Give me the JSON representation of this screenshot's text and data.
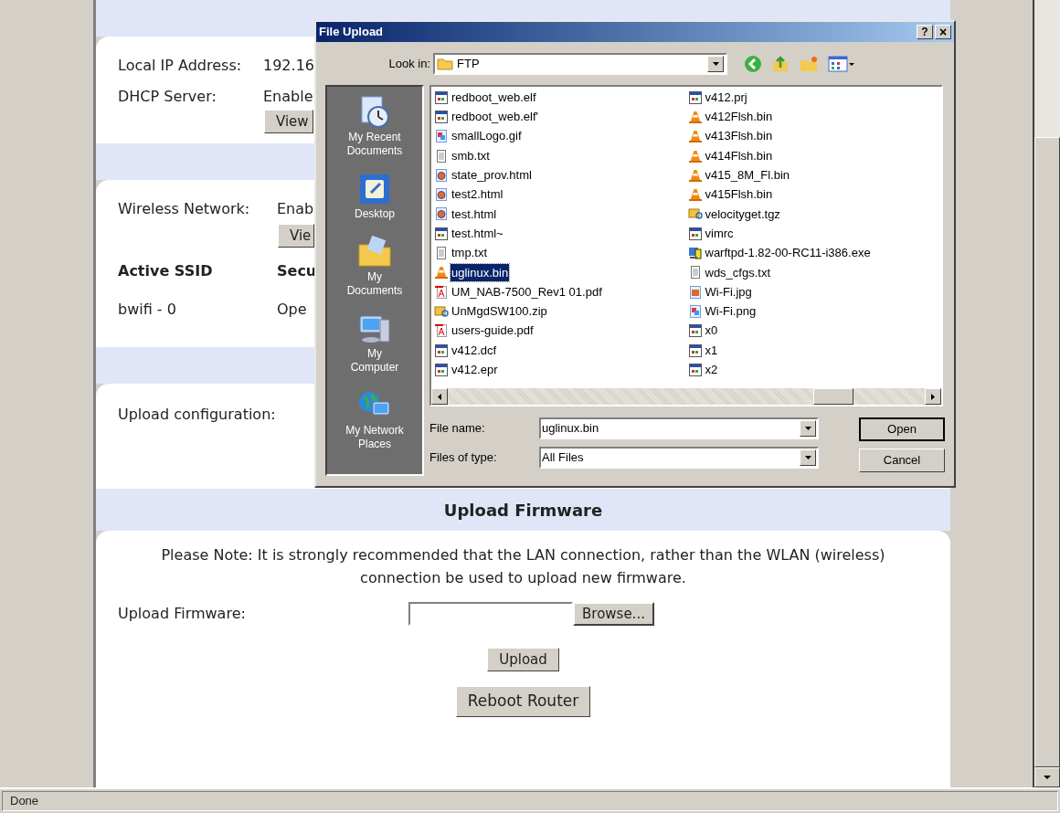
{
  "page": {
    "local": {
      "ip_label": "Local IP Address:",
      "ip_value": "192.16",
      "dhcp_label": "DHCP Server:",
      "dhcp_value": "Enable",
      "view_button": "View"
    },
    "wireless": {
      "label": "Wireless Network:",
      "value": "Enab",
      "view_button": "Vie",
      "columns": [
        "Active SSID",
        "Secu"
      ],
      "rows": [
        [
          "bwifi - 0",
          "Ope"
        ]
      ]
    },
    "config": {
      "label": "Upload configuration:"
    },
    "firmware": {
      "title": "Upload Firmware",
      "note": "Please Note: It is strongly recommended that the LAN connection, rather than the WLAN (wireless) connection be used to upload new firmware.",
      "label": "Upload Firmware:",
      "browse_button": "Browse...",
      "upload_button": "Upload",
      "reboot_button": "Reboot Router"
    }
  },
  "status_bar": "Done",
  "dialog": {
    "title": "File Upload",
    "help_button": "?",
    "close_button": "×",
    "look_in_label": "Look in:",
    "look_in_value": "FTP",
    "places": [
      {
        "label": "My Recent Documents",
        "kind": "recent"
      },
      {
        "label": "Desktop",
        "kind": "desktop"
      },
      {
        "label": "My Documents",
        "kind": "documents"
      },
      {
        "label": "My Computer",
        "kind": "computer"
      },
      {
        "label": "My Network Places",
        "kind": "network"
      }
    ],
    "files": [
      [
        {
          "name": "redboot_web.elf",
          "kind": "app",
          "selected": false
        },
        {
          "name": "redboot_web.elf'",
          "kind": "app",
          "selected": false
        },
        {
          "name": "smallLogo.gif",
          "kind": "image",
          "selected": false
        },
        {
          "name": "smb.txt",
          "kind": "text",
          "selected": false
        },
        {
          "name": "state_prov.html",
          "kind": "web",
          "selected": false
        },
        {
          "name": "test2.html",
          "kind": "web",
          "selected": false
        },
        {
          "name": "test.html",
          "kind": "web",
          "selected": false
        },
        {
          "name": "test.html~",
          "kind": "app",
          "selected": false
        },
        {
          "name": "tmp.txt",
          "kind": "text",
          "selected": false
        },
        {
          "name": "uglinux.bin",
          "kind": "cone",
          "selected": true
        },
        {
          "name": "UM_NAB-7500_Rev1 01.pdf",
          "kind": "pdf",
          "selected": false
        },
        {
          "name": "UnMgdSW100.zip",
          "kind": "archive",
          "selected": false
        },
        {
          "name": "users-guide.pdf",
          "kind": "pdf",
          "selected": false
        },
        {
          "name": "v412.dcf",
          "kind": "app",
          "selected": false
        },
        {
          "name": "v412.epr",
          "kind": "app",
          "selected": false
        }
      ],
      [
        {
          "name": "v412.prj",
          "kind": "app",
          "selected": false
        },
        {
          "name": "v412Flsh.bin",
          "kind": "cone",
          "selected": false
        },
        {
          "name": "v413Flsh.bin",
          "kind": "cone",
          "selected": false
        },
        {
          "name": "v414Flsh.bin",
          "kind": "cone",
          "selected": false
        },
        {
          "name": "v415_8M_Fl.bin",
          "kind": "cone",
          "selected": false
        },
        {
          "name": "v415Flsh.bin",
          "kind": "cone",
          "selected": false
        },
        {
          "name": "velocityget.tgz",
          "kind": "archive",
          "selected": false
        },
        {
          "name": "vimrc",
          "kind": "app",
          "selected": false
        },
        {
          "name": "warftpd-1.82-00-RC11-i386.exe",
          "kind": "exe",
          "selected": false
        },
        {
          "name": "wds_cfgs.txt",
          "kind": "text",
          "selected": false
        },
        {
          "name": "Wi-Fi.jpg",
          "kind": "photo",
          "selected": false
        },
        {
          "name": "Wi-Fi.png",
          "kind": "image",
          "selected": false
        },
        {
          "name": "x0",
          "kind": "app",
          "selected": false
        },
        {
          "name": "x1",
          "kind": "app",
          "selected": false
        },
        {
          "name": "x2",
          "kind": "app",
          "selected": false
        }
      ]
    ],
    "file_name_label": "File name:",
    "file_name_value": "uglinux.bin",
    "file_type_label": "Files of type:",
    "file_type_value": "All Files",
    "open_button": "Open",
    "cancel_button": "Cancel"
  }
}
